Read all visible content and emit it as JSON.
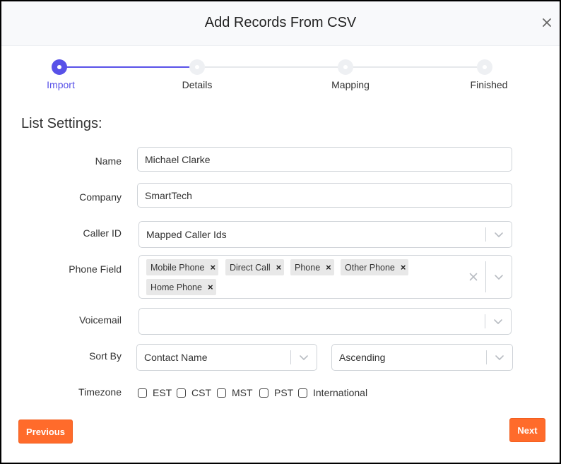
{
  "dialog": {
    "title": "Add Records From CSV",
    "close_icon": "close-icon"
  },
  "stepper": {
    "steps": [
      {
        "label": "Import",
        "state": "active"
      },
      {
        "label": "Details",
        "state": "pending"
      },
      {
        "label": "Mapping",
        "state": "pending"
      },
      {
        "label": "Finished",
        "state": "pending"
      }
    ],
    "accent_color": "#5851e8"
  },
  "section": {
    "title": "List Settings:"
  },
  "form": {
    "name": {
      "label": "Name",
      "value": "Michael Clarke"
    },
    "company": {
      "label": "Company",
      "value": "SmartTech"
    },
    "caller_id": {
      "label": "Caller ID",
      "value": "Mapped Caller Ids"
    },
    "phone_field": {
      "label": "Phone Field",
      "tags": [
        "Mobile Phone",
        "Direct Call",
        "Phone",
        "Other Phone",
        "Home Phone"
      ]
    },
    "voicemail": {
      "label": "Voicemail",
      "value": ""
    },
    "sort_by": {
      "label": "Sort By",
      "field": "Contact Name",
      "order": "Ascending"
    },
    "timezone": {
      "label": "Timezone",
      "options": [
        "EST",
        "CST",
        "MST",
        "PST",
        "International"
      ]
    }
  },
  "actions": {
    "previous": "Previous",
    "next": "Next",
    "button_color": "#ff6b2b"
  }
}
